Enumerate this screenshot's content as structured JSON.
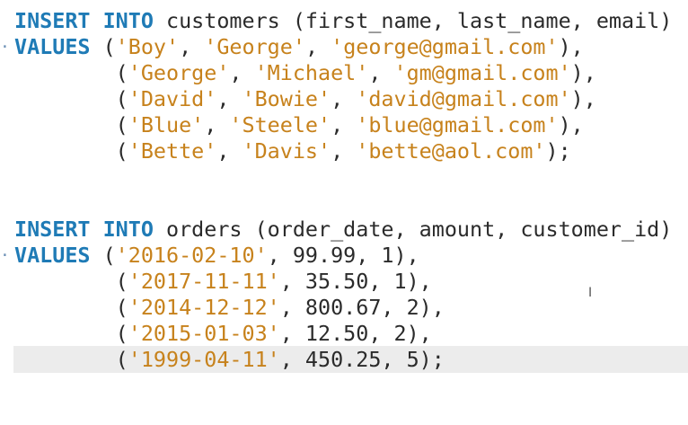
{
  "gutter": {
    "marker": "·"
  },
  "block1": {
    "l1": {
      "kw1": "INSERT",
      "kw2": "INTO",
      "rest": " customers (first_name, last_name, email)"
    },
    "l2": {
      "kw": "VALUES",
      "open": " (",
      "s1": "'Boy'",
      "c1": ", ",
      "s2": "'George'",
      "c2": ", ",
      "s3": "'george@gmail.com'",
      "close": "),"
    },
    "l3": {
      "open": "        (",
      "s1": "'George'",
      "c1": ", ",
      "s2": "'Michael'",
      "c2": ", ",
      "s3": "'gm@gmail.com'",
      "close": "),"
    },
    "l4": {
      "open": "        (",
      "s1": "'David'",
      "c1": ", ",
      "s2": "'Bowie'",
      "c2": ", ",
      "s3": "'david@gmail.com'",
      "close": "),"
    },
    "l5": {
      "open": "        (",
      "s1": "'Blue'",
      "c1": ", ",
      "s2": "'Steele'",
      "c2": ", ",
      "s3": "'blue@gmail.com'",
      "close": "),"
    },
    "l6": {
      "open": "        (",
      "s1": "'Bette'",
      "c1": ", ",
      "s2": "'Davis'",
      "c2": ", ",
      "s3": "'bette@aol.com'",
      "close": ");"
    }
  },
  "block2": {
    "l1": {
      "kw1": "INSERT",
      "kw2": "INTO",
      "rest": " orders (order_date, amount, customer_id)"
    },
    "l2": {
      "kw": "VALUES",
      "open": " (",
      "s1": "'2016-02-10'",
      "rest": ", 99.99, 1),"
    },
    "l3": {
      "open": "        (",
      "s1": "'2017-11-11'",
      "rest": ", 35.50, 1),"
    },
    "l4": {
      "open": "        (",
      "s1": "'2014-12-12'",
      "rest": ", 800.67, 2),"
    },
    "l5": {
      "open": "        (",
      "s1": "'2015-01-03'",
      "rest": ", 12.50, 2),"
    },
    "l6": {
      "open": "        (",
      "s1": "'1999-04-11'",
      "rest": ", 450.25, 5);"
    }
  },
  "cursor": {
    "glyph": "I"
  }
}
